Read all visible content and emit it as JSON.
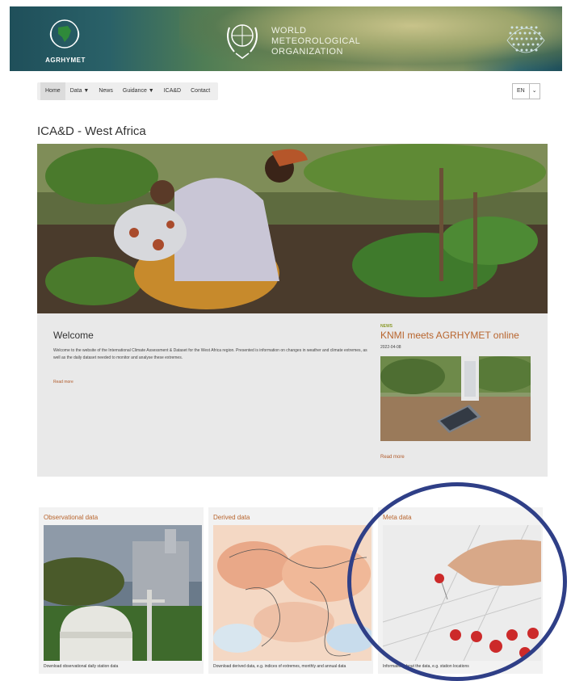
{
  "banner": {
    "agrhymet_label": "AGRHYMET",
    "wmo_lines": [
      "WORLD",
      "METEOROLOGICAL",
      "ORGANIZATION"
    ]
  },
  "nav": {
    "items": [
      {
        "label": "Home",
        "active": true
      },
      {
        "label": "Data ▼"
      },
      {
        "label": "News"
      },
      {
        "label": "Guidance ▼"
      },
      {
        "label": "ICA&D"
      },
      {
        "label": "Contact"
      }
    ]
  },
  "language": {
    "value": "EN",
    "caret": "⌄"
  },
  "page_title": "ICA&D - West Africa",
  "welcome": {
    "title": "Welcome",
    "body": "Welcome to the website of the International Climate Assessment & Dataset for the West Africa region. Presented is information on changes in weather and climate extremes, as well as the daily dataset needed to monitor and analyse these extremes.",
    "read_more": "Read more"
  },
  "news": {
    "tag": "NEWS",
    "title": "KNMI meets AGRHYMET online",
    "date": "2022-04-08",
    "read_more": "Read more"
  },
  "cards": [
    {
      "title": "Observational data",
      "description": "Download observational daily station data"
    },
    {
      "title": "Derived data",
      "description": "Download derived data, e.g. indices of extremes, monthly and annual data"
    },
    {
      "title": "Meta data",
      "description": "Information about the data, e.g. station locations"
    }
  ],
  "colors": {
    "accent": "#b8652e",
    "highlight_ring": "#2f3f87",
    "banner": "#1f4f5a"
  }
}
